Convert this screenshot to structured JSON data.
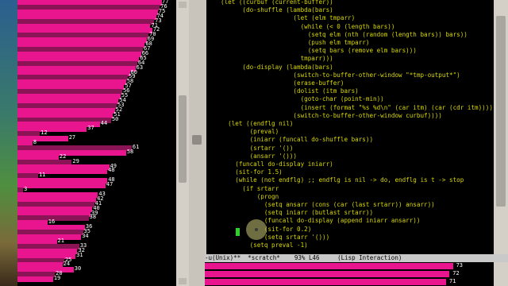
{
  "left_bars": [
    {
      "value": 77
    },
    {
      "value": 76
    },
    {
      "value": 75
    },
    {
      "value": 74
    },
    {
      "value": 73
    },
    {
      "value": 71
    },
    {
      "value": 72
    },
    {
      "value": 70
    },
    {
      "value": 69
    },
    {
      "value": 68
    },
    {
      "value": 67
    },
    {
      "value": 66
    },
    {
      "value": 65
    },
    {
      "value": 64
    },
    {
      "value": 63
    },
    {
      "value": 60
    },
    {
      "value": 59
    },
    {
      "value": 58
    },
    {
      "value": 57
    },
    {
      "value": 56
    },
    {
      "value": 55
    },
    {
      "value": 54
    },
    {
      "value": 53
    },
    {
      "value": 52
    },
    {
      "value": 51
    },
    {
      "value": 50
    },
    {
      "value": 44
    },
    {
      "value": 37
    },
    {
      "value": 12
    },
    {
      "value": 27
    },
    {
      "value": 8
    },
    {
      "value": 61
    },
    {
      "value": 58
    },
    {
      "value": 22
    },
    {
      "value": 29
    },
    {
      "value": 49
    },
    {
      "value": 48
    },
    {
      "value": 11
    },
    {
      "value": 48
    },
    {
      "value": 47
    },
    {
      "value": 3
    },
    {
      "value": 43
    },
    {
      "value": 42
    },
    {
      "value": 41
    },
    {
      "value": 40
    },
    {
      "value": 39
    },
    {
      "value": 38
    },
    {
      "value": 16
    },
    {
      "value": 36
    },
    {
      "value": 35
    },
    {
      "value": 34
    },
    {
      "value": 21
    },
    {
      "value": 33
    },
    {
      "value": 32
    },
    {
      "value": 31
    },
    {
      "value": 25
    },
    {
      "value": 24
    },
    {
      "value": 30
    },
    {
      "value": 20
    },
    {
      "value": 19
    }
  ],
  "code_lines": [
    "(let ((curbuf (current-buffer))",
    "      (do-shuffle (lambda(bars)",
    "                    (let (elm tmparr)",
    "                      (while (< 0 (length bars))",
    "                        (setq elm (nth (random (length bars)) bars))",
    "                        (push elm tmparr)",
    "                        (setq bars (remove elm bars)))",
    "                      tmparr)))",
    "      (do-display (lambda(bars)",
    "                    (switch-to-buffer-other-window \"*tmp-output*\")",
    "                    (erase-buffer)",
    "                    (dolist (itm bars)",
    "                      (goto-char (point-min))",
    "                      (insert (format \"%s %d\\n\" (car itm) (car (cdr itm)))))",
    "                    (switch-to-buffer-other-window curbuf))))",
    "  (let ((endflg nil)",
    "        (preval)",
    "        (iniarr (funcall do-shuffle bars))",
    "        (srtarr '())",
    "        (ansarr '()))",
    "    (funcall do-display iniarr)",
    "    (sit-for 1.5)",
    "    (while (not endflg) ;; endflg is nil -> do, endflg is t -> stop",
    "      (if srtarr",
    "          (progn",
    "            (setq ansarr (cons (car (last srtarr)) ansarr))",
    "            (setq iniarr (butlast srtarr))",
    "            (funcall do-display (append iniarr ansarr))",
    "            (sit-for 0.2)",
    "            (setq srtarr '()))",
    "        (setq preval -1)"
  ],
  "modeline": "-u(Unix)**  *scratch*    93% L46     (Lisp Interaction)",
  "bottom_bars": [
    {
      "value": 73
    },
    {
      "value": 72
    },
    {
      "value": 71
    }
  ],
  "colors": {
    "bar": "#e8158f",
    "code": "#d8d700",
    "cursor": "#2cd12c"
  }
}
